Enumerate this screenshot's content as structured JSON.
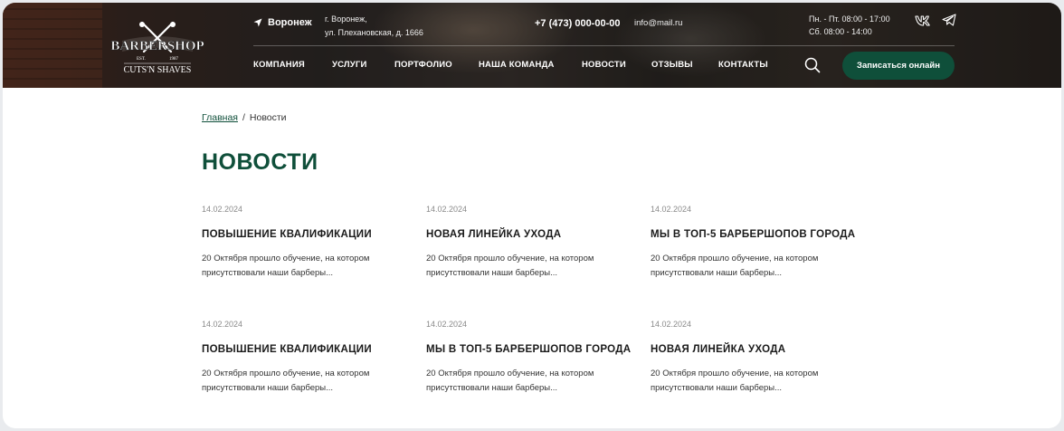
{
  "header": {
    "logo": {
      "top_text": "BARBERSHOP",
      "est": "EST.",
      "year": "1987",
      "bottom_text": "CUTS'N SHAVES"
    },
    "city": "Воронеж",
    "address_line1": "г. Воронеж,",
    "address_line2": "ул. Плехановская, д. 1666",
    "phone": "+7 (473) 000-00-00",
    "email": "info@mail.ru",
    "hours_line1": "Пн. - Пт. 08:00 - 17:00",
    "hours_line2": "Сб. 08:00 - 14:00",
    "nav": [
      "КОМПАНИЯ",
      "УСЛУГИ",
      "ПОРТФОЛИО",
      "НАША КОМАНДА",
      "НОВОСТИ",
      "ОТЗЫВЫ",
      "КОНТАКТЫ"
    ],
    "cta_label": "Записаться онлайн"
  },
  "breadcrumb": {
    "home": "Главная",
    "separator": "/",
    "current": "Новости"
  },
  "page_title": "НОВОСТИ",
  "news": [
    {
      "date": "14.02.2024",
      "title": "ПОВЫШЕНИЕ КВАЛИФИКАЦИИ",
      "excerpt": "20 Октября прошло обучение, на котором присутствовали наши барберы..."
    },
    {
      "date": "14.02.2024",
      "title": "НОВАЯ ЛИНЕЙКА УХОДА",
      "excerpt": "20 Октября прошло обучение, на котором присутствовали наши барберы..."
    },
    {
      "date": "14.02.2024",
      "title": "МЫ В ТОП-5 БАРБЕРШОПОВ ГОРОДА",
      "excerpt": "20 Октября прошло обучение, на котором присутствовали наши барберы..."
    },
    {
      "date": "14.02.2024",
      "title": "ПОВЫШЕНИЕ КВАЛИФИКАЦИИ",
      "excerpt": "20 Октября прошло обучение, на котором присутствовали наши барберы..."
    },
    {
      "date": "14.02.2024",
      "title": "МЫ В ТОП-5 БАРБЕРШОПОВ ГОРОДА",
      "excerpt": "20 Октября прошло обучение, на котором присутствовали наши барберы..."
    },
    {
      "date": "14.02.2024",
      "title": "НОВАЯ ЛИНЕЙКА УХОДА",
      "excerpt": "20 Октября прошло обучение, на котором присутствовали наши барберы..."
    }
  ],
  "icons": {
    "location": "location-arrow-icon",
    "vk": "vk-icon",
    "telegram": "telegram-icon",
    "search": "search-icon"
  },
  "colors": {
    "brand_green": "#0f4f3a",
    "date_gray": "#8a8a8a"
  }
}
